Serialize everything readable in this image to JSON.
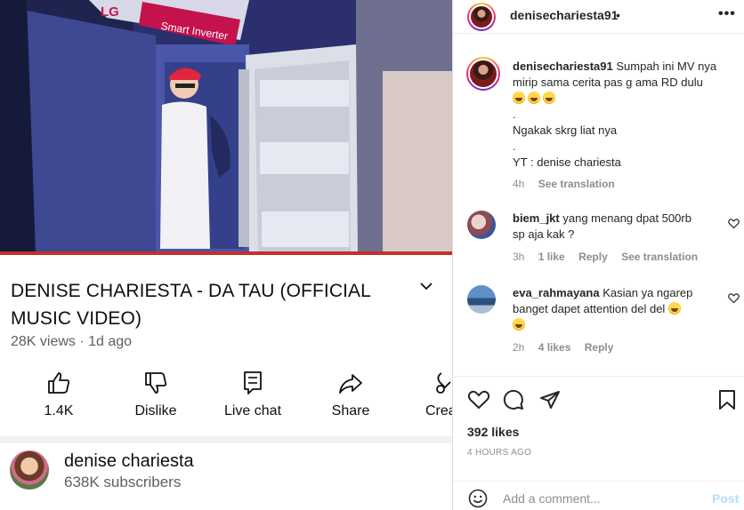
{
  "youtube": {
    "video": {
      "scene_text": "Smart Inverter",
      "brand": "LG",
      "progress_fraction": 0.0
    },
    "title": "DENISE CHARIESTA - DA TAU (OFFICIAL MUSIC VIDEO)",
    "meta": "28K views · 1d ago",
    "actions": [
      {
        "label": "1.4K",
        "icon": "thumbs-up-icon"
      },
      {
        "label": "Dislike",
        "icon": "thumbs-down-icon"
      },
      {
        "label": "Live chat",
        "icon": "live-chat-icon"
      },
      {
        "label": "Share",
        "icon": "share-icon"
      },
      {
        "label": "Crea",
        "icon": "create-icon"
      }
    ],
    "channel": {
      "name": "denise chariesta",
      "subscribers": "638K subscribers"
    }
  },
  "instagram": {
    "header": {
      "username": "denisechariesta91",
      "dot": "•",
      "more": "•••"
    },
    "caption": {
      "username": "denisechariesta91",
      "line1": "Sumpah ini MV nya",
      "line2": "mirip sama cerita pas g ama RD dulu",
      "dot1": ".",
      "line3": "Ngakak skrg liat nya",
      "dot2": ".",
      "line4": "YT : denise chariesta",
      "time": "4h",
      "see_translation": "See translation"
    },
    "comments": [
      {
        "username": "biem_jkt",
        "text_line1": "yang menang dpat 500rb",
        "text_line2": "sp aja kak ?",
        "time": "3h",
        "likes": "1 like",
        "reply": "Reply",
        "see_translation": "See translation"
      },
      {
        "username": "eva_rahmayana",
        "text_line1": "Kasian ya ngarep",
        "text_line2": "banget dapet attention del del",
        "time": "2h",
        "likes": "4 likes",
        "reply": "Reply"
      }
    ],
    "likes": "392 likes",
    "posted": "4 HOURS AGO",
    "add_comment_placeholder": "Add a comment...",
    "post_button": "Post",
    "colors": {
      "post_disabled": "#b2dffc",
      "muted": "#8e8e8e"
    }
  }
}
